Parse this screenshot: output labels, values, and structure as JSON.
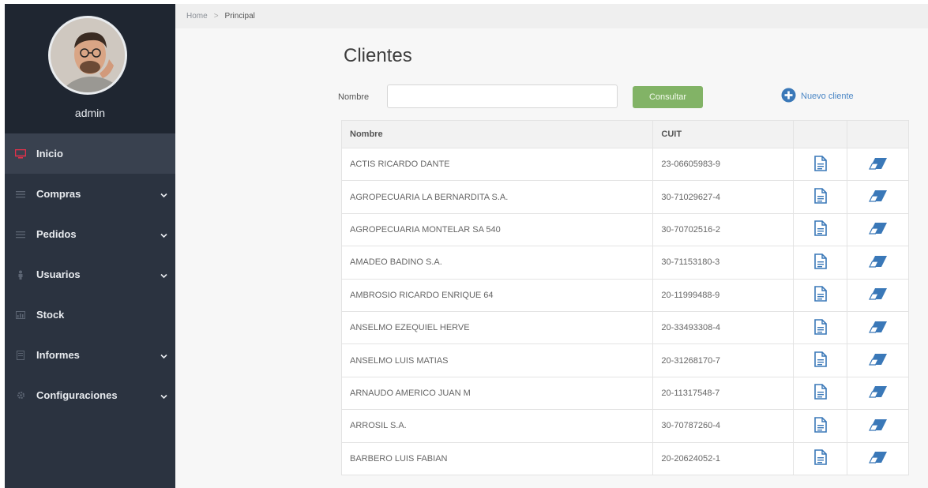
{
  "sidebar": {
    "user_name": "admin",
    "items": [
      {
        "label": "Inicio",
        "icon": "monitor-icon",
        "has_submenu": false
      },
      {
        "label": "Compras",
        "icon": "list-icon",
        "has_submenu": true
      },
      {
        "label": "Pedidos",
        "icon": "list-icon",
        "has_submenu": true
      },
      {
        "label": "Usuarios",
        "icon": "user-icon",
        "has_submenu": true
      },
      {
        "label": "Stock",
        "icon": "chart-icon",
        "has_submenu": false
      },
      {
        "label": "Informes",
        "icon": "document-icon",
        "has_submenu": true
      },
      {
        "label": "Configuraciones",
        "icon": "gear-icon",
        "has_submenu": true
      }
    ]
  },
  "breadcrumb": {
    "home": "Home",
    "separator": ">",
    "current": "Principal"
  },
  "page": {
    "title": "Clientes"
  },
  "search": {
    "label": "Nombre",
    "value": "",
    "button": "Consultar"
  },
  "new_client": {
    "label": "Nuevo cliente"
  },
  "table": {
    "headers": {
      "name": "Nombre",
      "cuit": "CUIT",
      "actions": ""
    },
    "rows": [
      {
        "name": "ACTIS RICARDO DANTE",
        "cuit": "23-06605983-9"
      },
      {
        "name": "AGROPECUARIA LA BERNARDITA S.A.",
        "cuit": "30-71029627-4"
      },
      {
        "name": "AGROPECUARIA MONTELAR SA 540",
        "cuit": "30-70702516-2"
      },
      {
        "name": "AMADEO BADINO S.A.",
        "cuit": "30-71153180-3"
      },
      {
        "name": "AMBROSIO RICARDO ENRIQUE 64",
        "cuit": "20-11999488-9"
      },
      {
        "name": "ANSELMO EZEQUIEL HERVE",
        "cuit": "20-33493308-4"
      },
      {
        "name": "ANSELMO LUIS MATIAS",
        "cuit": "20-31268170-7"
      },
      {
        "name": "ARNAUDO AMERICO JUAN M",
        "cuit": "20-11317548-7"
      },
      {
        "name": "ARROSIL S.A.",
        "cuit": "30-70787260-4"
      },
      {
        "name": "BARBERO LUIS FABIAN",
        "cuit": "20-20624052-1"
      }
    ]
  },
  "colors": {
    "sidebar_bg": "#2b3340",
    "profile_bg": "#1f2631",
    "active_item_bg": "#39414f",
    "accent_red": "#e0314a",
    "button_green": "#82b366",
    "link_blue": "#4a86c5",
    "icon_blue": "#3a78b8"
  }
}
